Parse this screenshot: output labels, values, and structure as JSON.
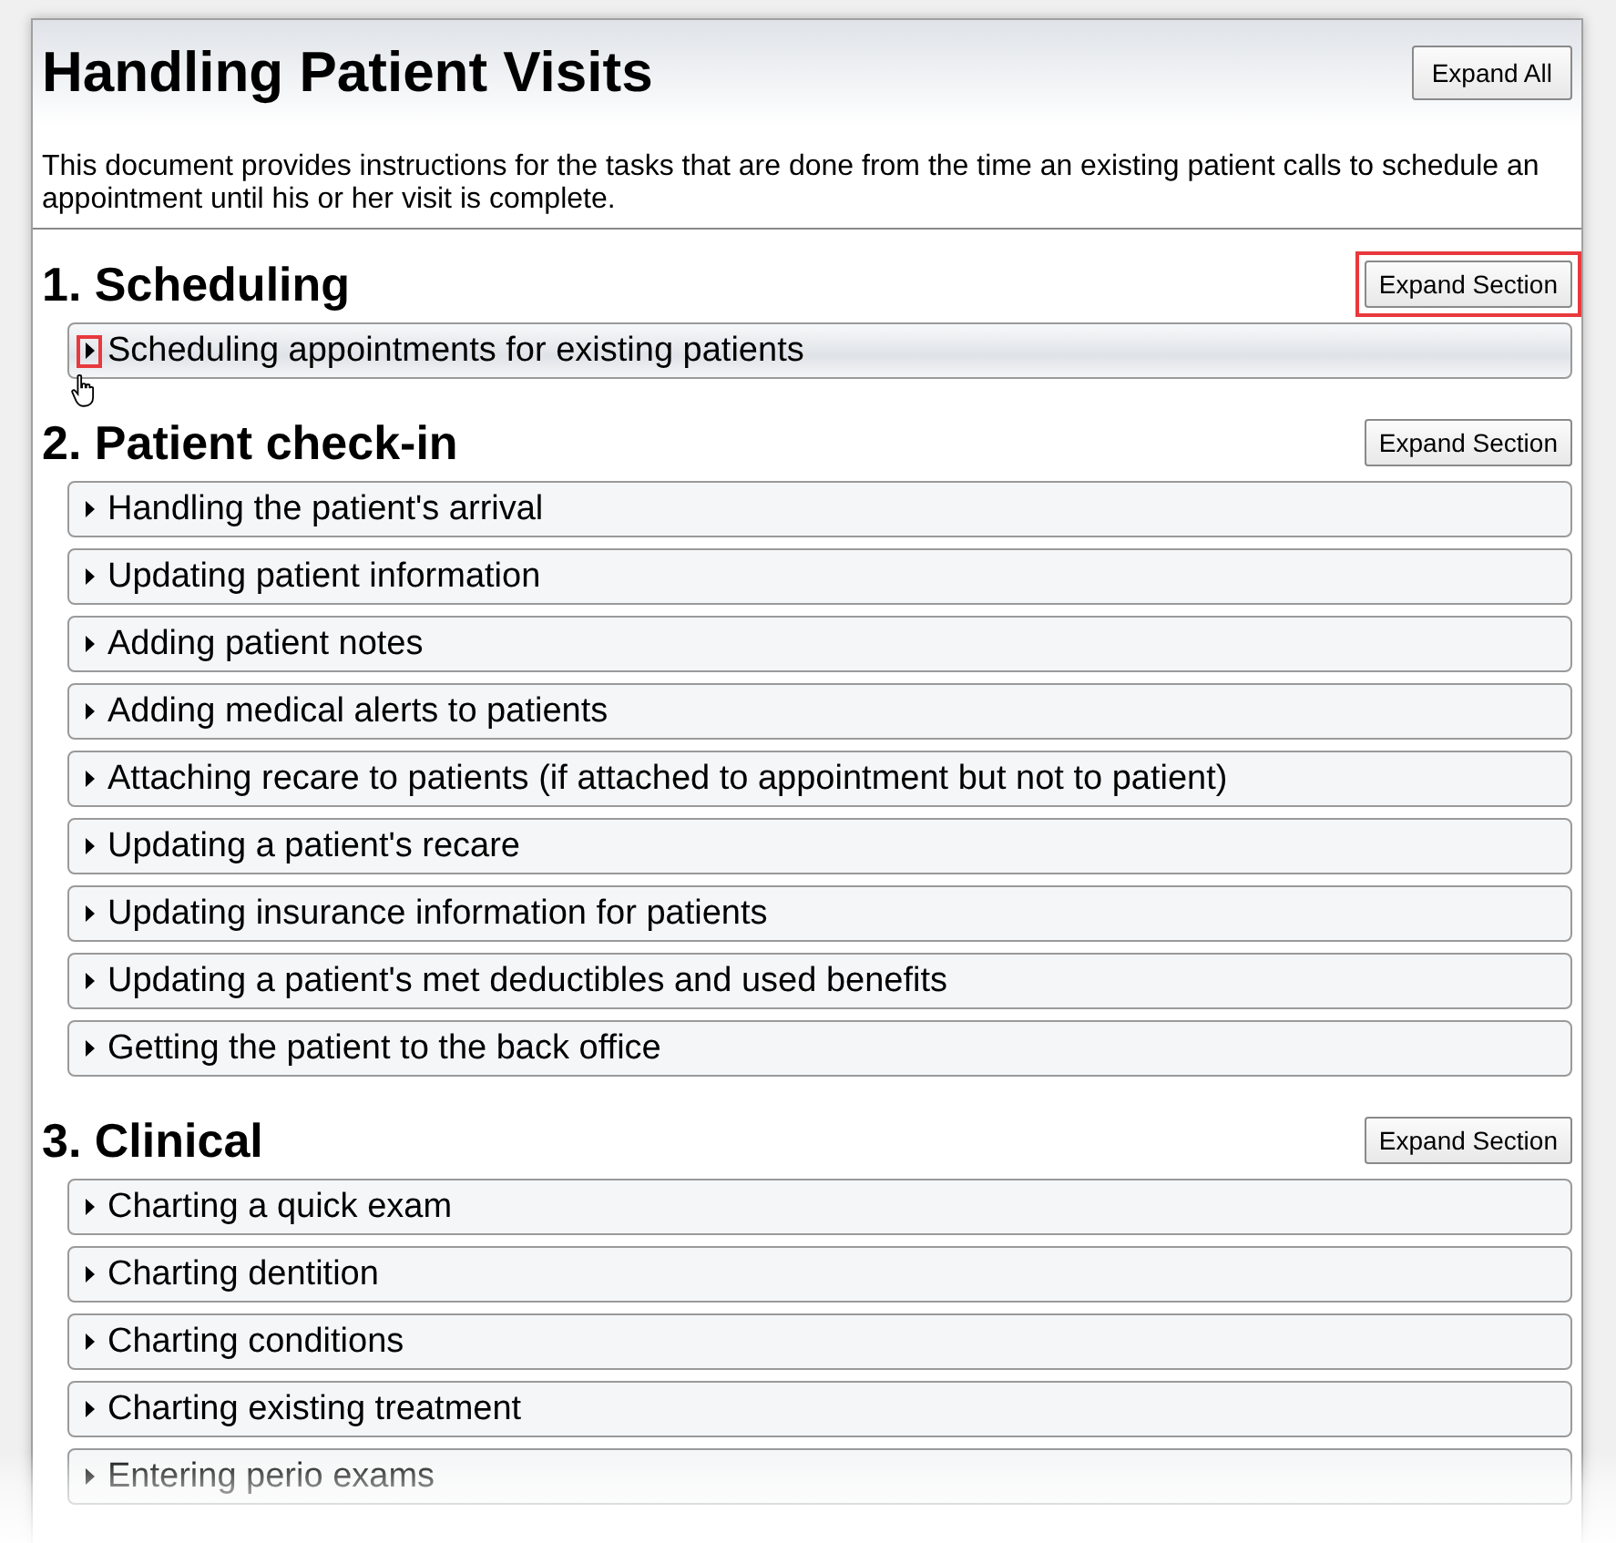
{
  "title": "Handling Patient Visits",
  "expand_all": {
    "label": "Expand All"
  },
  "description": "This document provides instructions for the tasks that are done from the time an existing patient calls to schedule an appointment until his or her visit is complete.",
  "sections": [
    {
      "heading": "1. Scheduling",
      "button": {
        "label": "Expand Section",
        "highlighted": true
      },
      "items": [
        {
          "label": "Scheduling appointments for existing patients",
          "hovered": true,
          "toggle_highlighted": true
        }
      ]
    },
    {
      "heading": "2. Patient check-in",
      "button": {
        "label": "Expand Section",
        "highlighted": false
      },
      "items": [
        {
          "label": "Handling the patient's arrival",
          "hovered": false,
          "toggle_highlighted": false
        },
        {
          "label": "Updating patient information",
          "hovered": false,
          "toggle_highlighted": false
        },
        {
          "label": "Adding patient notes",
          "hovered": false,
          "toggle_highlighted": false
        },
        {
          "label": "Adding medical alerts to patients",
          "hovered": false,
          "toggle_highlighted": false
        },
        {
          "label": "Attaching recare to patients (if attached to appointment but not to patient)",
          "hovered": false,
          "toggle_highlighted": false
        },
        {
          "label": "Updating a patient's recare",
          "hovered": false,
          "toggle_highlighted": false
        },
        {
          "label": "Updating insurance information for patients",
          "hovered": false,
          "toggle_highlighted": false
        },
        {
          "label": "Updating a patient's met deductibles and used benefits",
          "hovered": false,
          "toggle_highlighted": false
        },
        {
          "label": "Getting the patient to the back office",
          "hovered": false,
          "toggle_highlighted": false
        }
      ]
    },
    {
      "heading": "3. Clinical",
      "button": {
        "label": "Expand Section",
        "highlighted": false
      },
      "items": [
        {
          "label": "Charting a quick exam",
          "hovered": false,
          "toggle_highlighted": false
        },
        {
          "label": "Charting dentition",
          "hovered": false,
          "toggle_highlighted": false
        },
        {
          "label": "Charting conditions",
          "hovered": false,
          "toggle_highlighted": false
        },
        {
          "label": "Charting existing treatment",
          "hovered": false,
          "toggle_highlighted": false
        },
        {
          "label": "Entering perio exams",
          "hovered": false,
          "toggle_highlighted": false
        }
      ]
    }
  ]
}
